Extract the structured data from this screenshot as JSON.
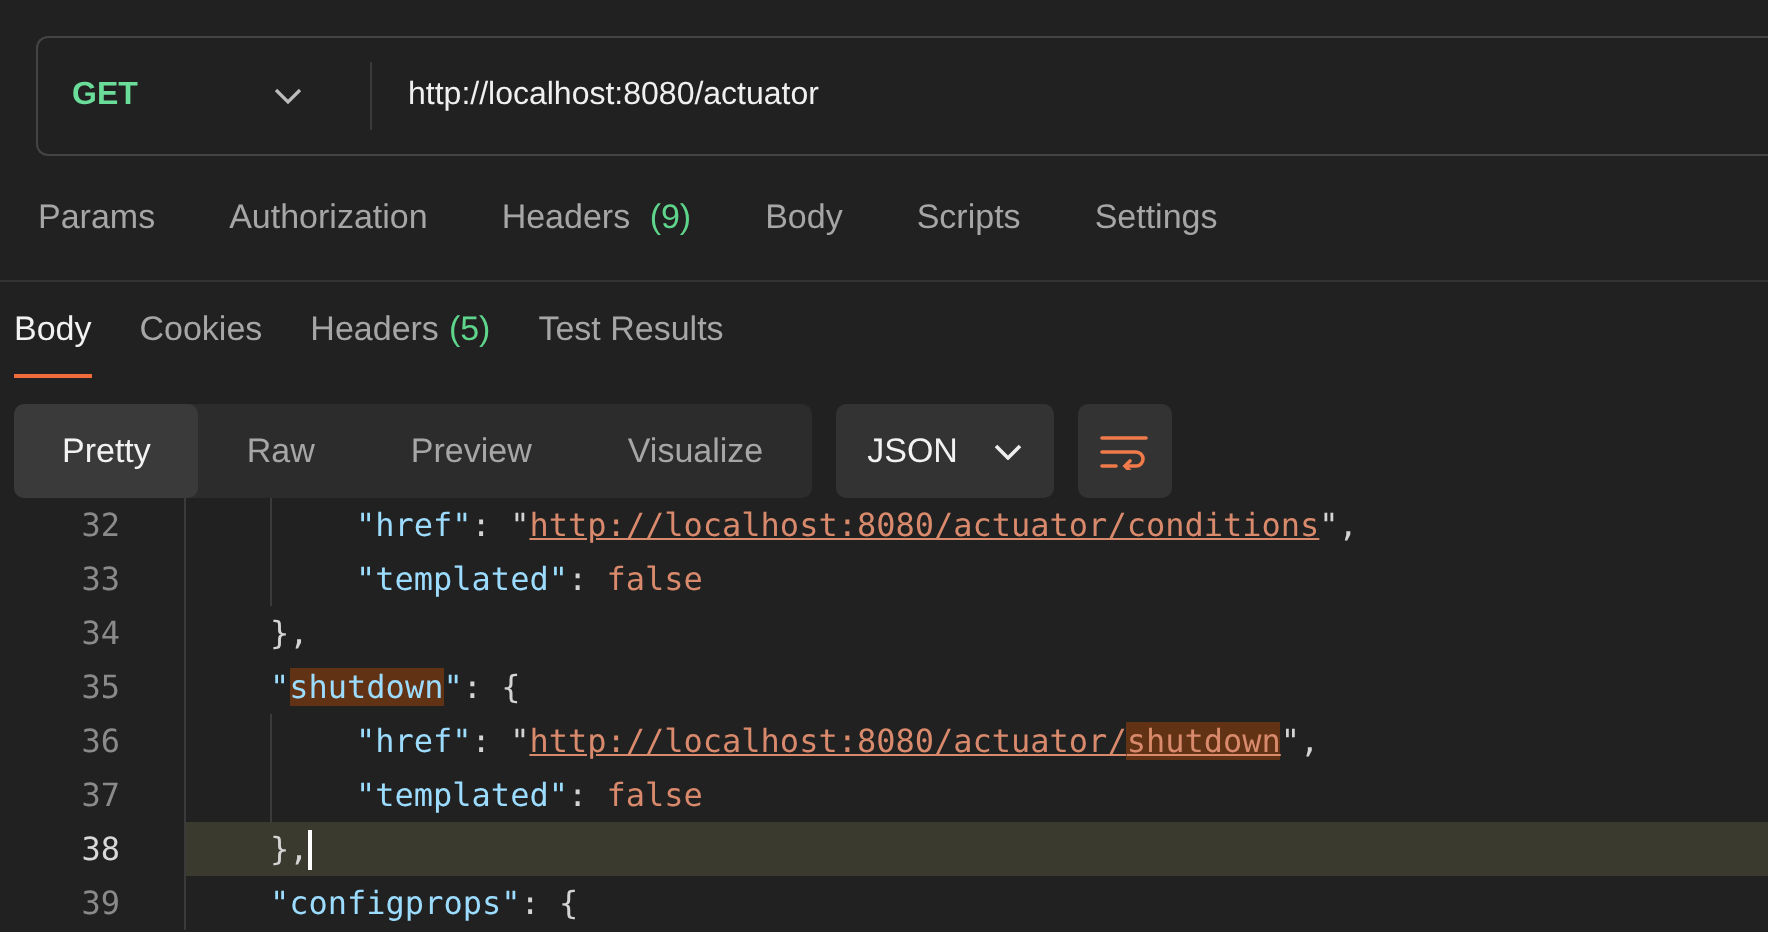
{
  "request": {
    "method": "GET",
    "url": "http://localhost:8080/actuator"
  },
  "request_tabs": [
    {
      "label": "Params"
    },
    {
      "label": "Authorization"
    },
    {
      "label": "Headers",
      "count": "(9)"
    },
    {
      "label": "Body"
    },
    {
      "label": "Scripts"
    },
    {
      "label": "Settings"
    }
  ],
  "response_tabs": [
    {
      "label": "Body",
      "selected": true
    },
    {
      "label": "Cookies",
      "selected": false
    },
    {
      "label": "Headers",
      "count": "(5)",
      "selected": false
    },
    {
      "label": "Test Results",
      "selected": false
    }
  ],
  "view_modes": [
    {
      "label": "Pretty",
      "selected": true
    },
    {
      "label": "Raw",
      "selected": false
    },
    {
      "label": "Preview",
      "selected": false
    },
    {
      "label": "Visualize",
      "selected": false
    }
  ],
  "format": "JSON",
  "code_lines": [
    {
      "children": [
        {
          "number": "32",
          "current": false,
          "tokens": [
            {
              "kind": "key",
              "text": "\"href\""
            },
            {
              "kind": "punct",
              "text": ": \""
            },
            {
              "kind": "url",
              "text": "http://localhost:8080/actuator/conditions"
            },
            {
              "kind": "punct",
              "text": "\","
            }
          ]
        },
        {
          "number": "33",
          "current": false,
          "tokens": [
            {
              "kind": "key",
              "text": "\"templated\""
            },
            {
              "kind": "punct",
              "text": ": "
            },
            {
              "kind": "bool",
              "text": "false"
            }
          ]
        }
      ]
    },
    {
      "number": "34",
      "current": false,
      "tokens": [
        {
          "kind": "punct",
          "text": "},"
        }
      ]
    },
    {
      "number": "35",
      "current": false,
      "tokens": [
        {
          "kind": "key",
          "text": "\"",
          "highlight": false
        },
        {
          "kind": "key",
          "text": "shutdown",
          "highlight": true
        },
        {
          "kind": "key",
          "text": "\"",
          "highlight": false
        },
        {
          "kind": "punct",
          "text": ": {"
        }
      ],
      "children": [
        {
          "number": "36",
          "current": false,
          "tokens": [
            {
              "kind": "key",
              "text": "\"href\""
            },
            {
              "kind": "punct",
              "text": ": \""
            },
            {
              "kind": "url",
              "text": "http://localhost:8080/actuator/",
              "highlight": false
            },
            {
              "kind": "url",
              "text": "shutdown",
              "highlight": true
            },
            {
              "kind": "punct",
              "text": "\","
            }
          ]
        },
        {
          "number": "37",
          "current": false,
          "tokens": [
            {
              "kind": "key",
              "text": "\"templated\""
            },
            {
              "kind": "punct",
              "text": ": "
            },
            {
              "kind": "bool",
              "text": "false"
            }
          ]
        }
      ]
    },
    {
      "number": "38",
      "current": true,
      "tokens": [
        {
          "kind": "punct",
          "text": "},"
        }
      ]
    },
    {
      "number": "39",
      "current": false,
      "tokens": [
        {
          "kind": "key",
          "text": "\"configprops\""
        },
        {
          "kind": "punct",
          "text": ": {"
        }
      ]
    }
  ]
}
